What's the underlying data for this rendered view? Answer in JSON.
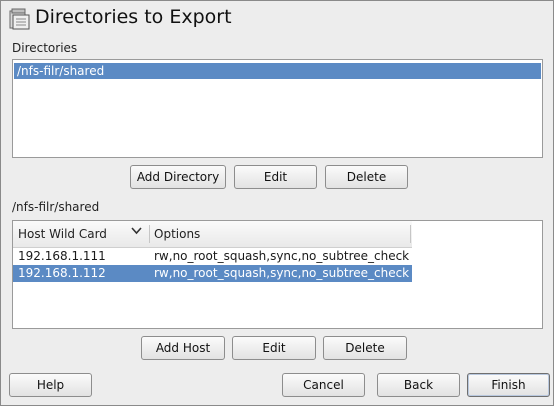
{
  "title": "Directories to Export",
  "directories_label": "Directories",
  "directories": [
    "/nfs-filr/shared"
  ],
  "dir_buttons": {
    "add": "Add Directory",
    "edit": "Edit",
    "delete": "Delete"
  },
  "selected_dir_label": "/nfs-filr/shared",
  "host_table": {
    "columns": [
      "Host Wild Card",
      "Options"
    ],
    "rows": [
      {
        "host": "192.168.1.111",
        "options": "rw,no_root_squash,sync,no_subtree_check",
        "selected": false
      },
      {
        "host": "192.168.1.112",
        "options": "rw,no_root_squash,sync,no_subtree_check",
        "selected": true
      }
    ]
  },
  "host_buttons": {
    "add": "Add Host",
    "edit": "Edit",
    "delete": "Delete"
  },
  "footer": {
    "help": "Help",
    "cancel": "Cancel",
    "back": "Back",
    "finish": "Finish"
  },
  "colors": {
    "selection": "#5b8ac4",
    "background": "#ededed"
  },
  "icons": {
    "title": "nfs-export-icon",
    "sort": "chevron-down-icon"
  }
}
